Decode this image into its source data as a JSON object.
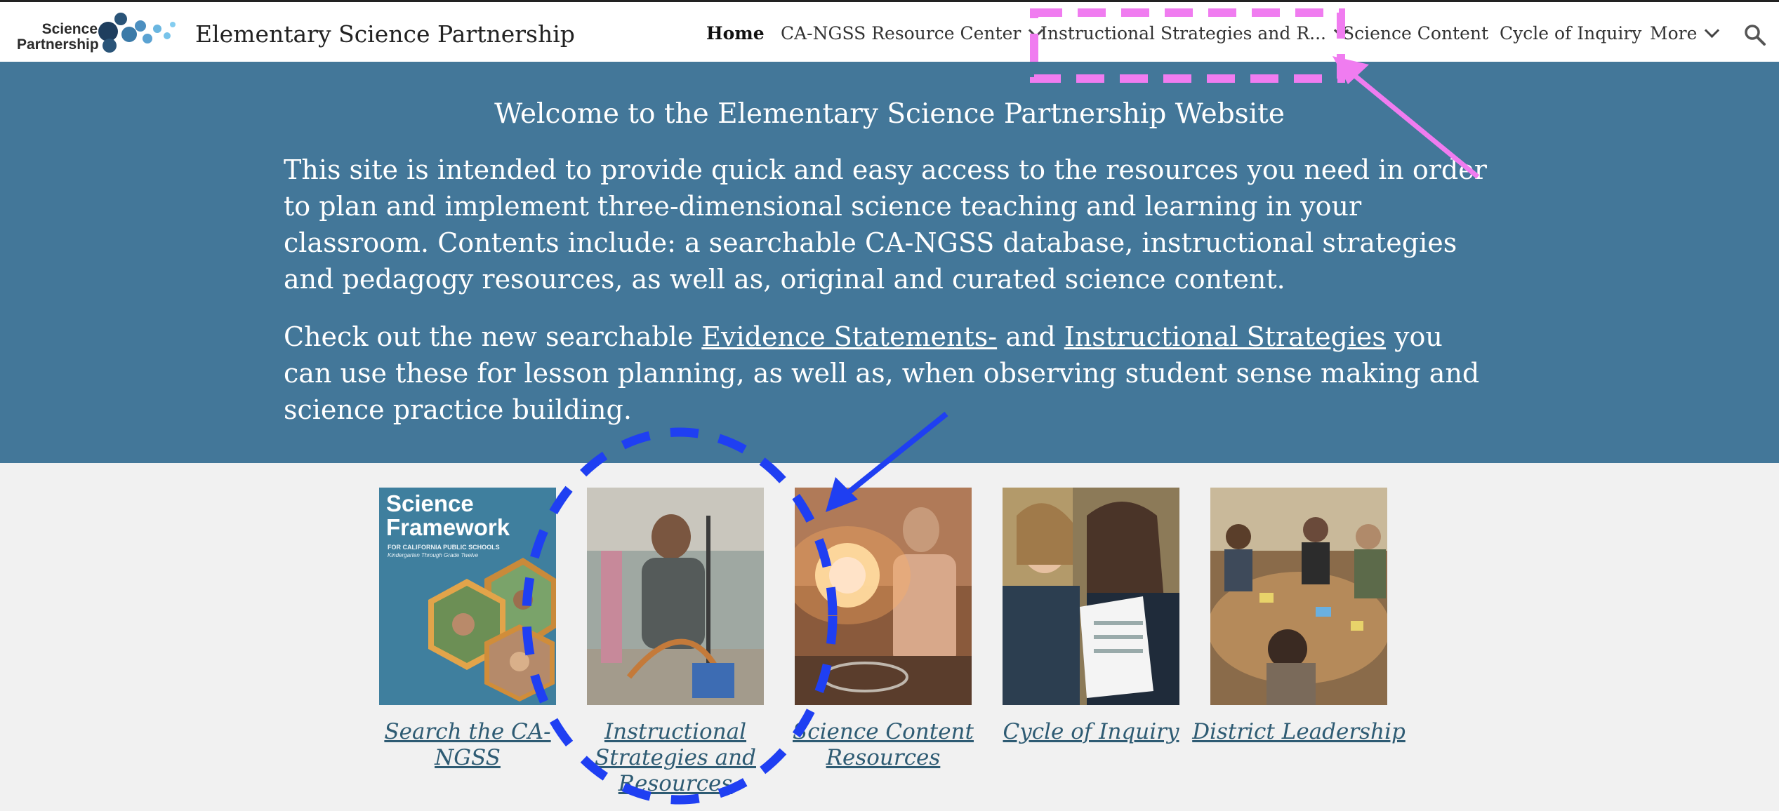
{
  "header": {
    "logo_text_line1": "Science",
    "logo_text_line2": "Partnership",
    "site_title": "Elementary Science Partnership",
    "nav": [
      {
        "label": "Home",
        "active": true,
        "has_dropdown": false
      },
      {
        "label": "CA-NGSS Resource Center",
        "active": false,
        "has_dropdown": true
      },
      {
        "label": "Instructional Strategies and R...",
        "active": false,
        "has_dropdown": true
      },
      {
        "label": "Science Content",
        "active": false,
        "has_dropdown": false
      },
      {
        "label": "Cycle of Inquiry",
        "active": false,
        "has_dropdown": false
      },
      {
        "label": "More",
        "active": false,
        "has_dropdown": true
      }
    ],
    "search_icon": "search-icon"
  },
  "hero": {
    "title": "Welcome to the Elementary Science Partnership Website",
    "paragraph1": "This site is intended to provide quick and easy access to the resources you need in order to plan and implement three-dimensional science teaching and learning in your classroom.  Contents include: a searchable CA-NGSS database, instructional strategies and pedagogy resources, as well as, original and curated science content.",
    "paragraph2_prefix": "Check out the new searchable ",
    "paragraph2_link1": "Evidence Statements-",
    "paragraph2_middle": " and ",
    "paragraph2_link2": "Instructional Strategies",
    "paragraph2_suffix": " you can use these for lesson planning, as well as, when observing student sense making and science practice building.",
    "background_color": "#437799"
  },
  "tiles": [
    {
      "caption": "Search the CA-NGSS",
      "image": "science-framework-cover"
    },
    {
      "caption": "Instructional Strategies and Resources",
      "image": "teacher-demonstration-photo"
    },
    {
      "caption": "Science Content Resources",
      "image": "flame-experiment-photo"
    },
    {
      "caption": "Cycle of Inquiry",
      "image": "teachers-reviewing-papers-photo"
    },
    {
      "caption": "District Leadership",
      "image": "group-table-meeting-photo"
    }
  ],
  "framework_cover": {
    "title_line1": "Science",
    "title_line2": "Framework",
    "subtitle": "FOR CALIFORNIA PUBLIC SCHOOLS",
    "subtitle2": "Kindergarten Through Grade Twelve"
  },
  "annotations": {
    "magenta_color": "#f07cf0",
    "blue_color": "#1f3ff2"
  }
}
